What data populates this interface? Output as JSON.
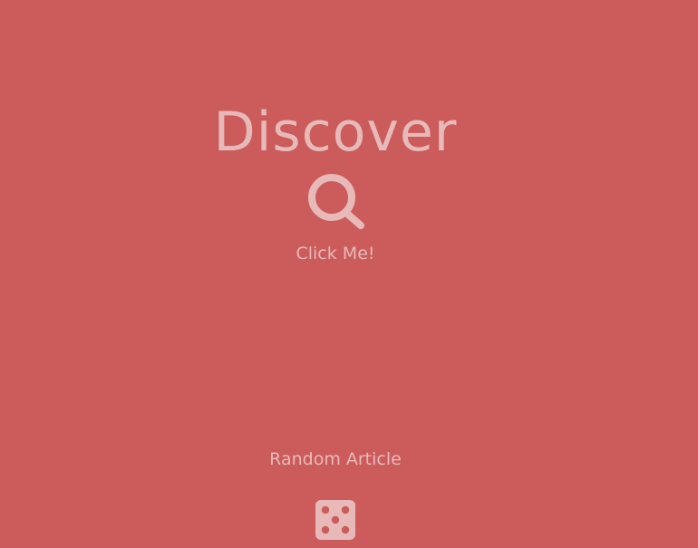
{
  "hero": {
    "title": "Discover",
    "search_icon": "search-icon",
    "search_label": "Click Me!"
  },
  "random": {
    "label": "Random Article",
    "dice_icon": "dice-five-icon"
  },
  "colors": {
    "background": "#cb5c5b",
    "foreground": "#e7b9b9"
  }
}
